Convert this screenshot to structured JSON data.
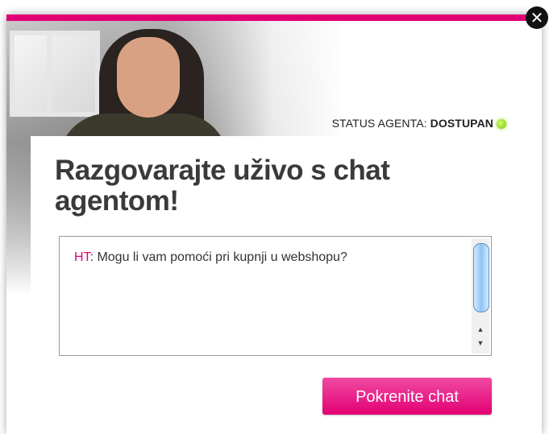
{
  "status": {
    "label": "STATUS AGENTA: ",
    "value": "DOSTUPAN",
    "indicator_color": "#74c10a"
  },
  "heading": "Razgovarajte uživo s chat agentom!",
  "chat": {
    "messages": [
      {
        "sender": "HT",
        "separator": ": ",
        "text": "Mogu li vam pomoći pri kupnji u webshopu?"
      }
    ]
  },
  "start_button": {
    "label": "Pokrenite chat"
  },
  "close_button": {
    "icon": "close-icon",
    "glyph": "✕"
  },
  "scrollbar": {
    "up_glyph": "▲",
    "down_glyph": "▼"
  },
  "colors": {
    "brand": "#e20074"
  }
}
